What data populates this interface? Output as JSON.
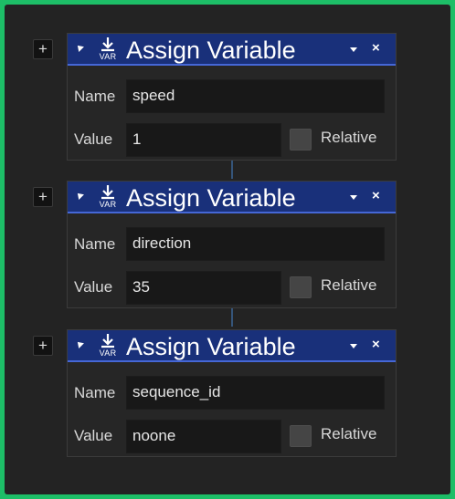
{
  "blocks": [
    {
      "title": "Assign Variable",
      "icon_caption": "VAR",
      "name_label": "Name",
      "name_value": "speed",
      "value_label": "Value",
      "value_value": "1",
      "relative_label": "Relative"
    },
    {
      "title": "Assign Variable",
      "icon_caption": "VAR",
      "name_label": "Name",
      "name_value": "direction",
      "value_label": "Value",
      "value_value": "35",
      "relative_label": "Relative"
    },
    {
      "title": "Assign Variable",
      "icon_caption": "VAR",
      "name_label": "Name",
      "name_value": "sequence_id",
      "value_label": "Value",
      "value_value": "noone",
      "relative_label": "Relative"
    }
  ],
  "controls": {
    "add_symbol": "+",
    "close_symbol": "×"
  },
  "icons": {
    "add": "plus-icon",
    "collapse": "collapse-arrow-icon",
    "variable": "var-download-icon",
    "menu": "dropdown-arrow-icon",
    "close": "close-icon",
    "relative": "checkbox"
  },
  "colors": {
    "frame_border": "#1dbe67",
    "background": "#232323",
    "header": "#19307a",
    "header_accent": "#4567d6",
    "panel": "#262626",
    "field": "#181818",
    "connector": "#35557a"
  }
}
